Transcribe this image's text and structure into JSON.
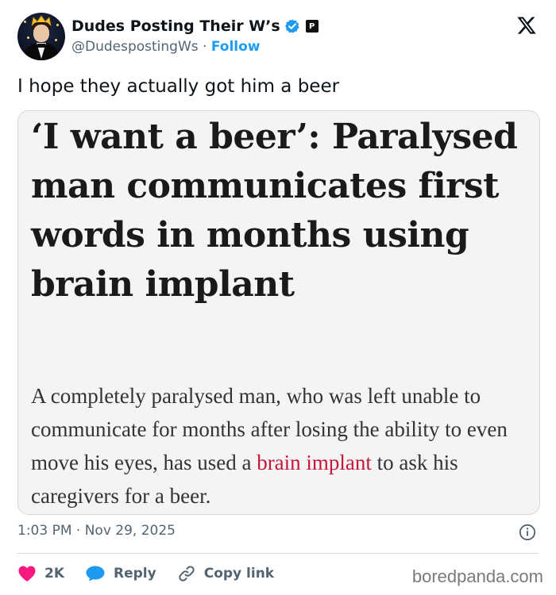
{
  "author": {
    "display_name": "Dudes Posting Their W’s",
    "handle": "@DudespostingWs",
    "separator": "·",
    "follow_label": "Follow",
    "affiliate_badge_text": "P",
    "verified_color": "#1d9bf0"
  },
  "tweet": {
    "text": "I hope they actually got him a beer"
  },
  "article": {
    "headline": "‘I want a beer’: Paralysed man communicates first words in months using brain implant",
    "standfirst_before": "A completely paralysed man, who was left unable to communicate for months after losing the ability to even move his eyes, has used a ",
    "standfirst_link": "brain implant",
    "standfirst_after": " to ask his caregivers for a beer.",
    "link_color": "#c7153b"
  },
  "meta": {
    "timestamp": "1:03 PM · Nov 29, 2025"
  },
  "actions": {
    "like_count": "2K",
    "reply_label": "Reply",
    "copy_link_label": "Copy link",
    "like_color": "#f91880",
    "reply_color": "#1d9bf0"
  },
  "watermark": "boredpanda.com",
  "icons": {
    "verified": "verified-check-icon",
    "x_logo": "x-logo-icon",
    "info": "info-icon",
    "heart": "heart-icon",
    "reply": "speech-bubble-icon",
    "link": "link-icon"
  }
}
